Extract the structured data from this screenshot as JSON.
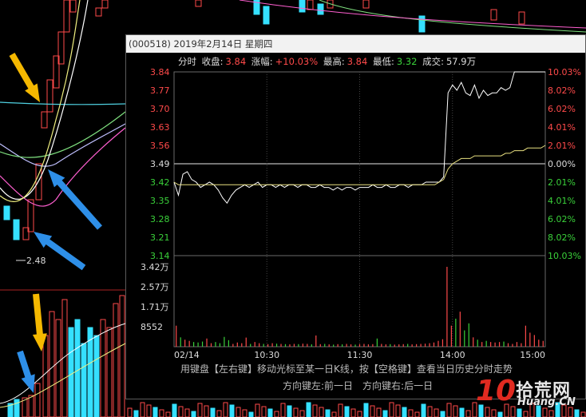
{
  "popup": {
    "title": "(000518) 2019年2月14日 星期四",
    "stats": {
      "label": "分时",
      "close_label": "收盘:",
      "close_value": "3.84",
      "change_label": "涨幅:",
      "change_value": "+10.03%",
      "high_label": "最高:",
      "high_value": "3.84",
      "low_label": "最低:",
      "low_value": "3.32",
      "volume_label": "成交:",
      "volume_value": "57.9万"
    },
    "hint_line1": "用键盘【左右键】移动光标至某一日K线，按【空格键】查看当日历史分时走势",
    "hint_line2": "方向键左:前一日　方向键右:后一日"
  },
  "kline_label": "2.48",
  "watermark": {
    "big": "10",
    "cn": "拾荒网",
    "domain": "Huang.CN"
  },
  "colors": {
    "up": "#ff4a4a",
    "down": "#3ad13a",
    "neutral": "#dddddd",
    "price_line": "#ffffff",
    "avg_line": "#e8e080",
    "arrow_yellow": "#f5b800",
    "arrow_blue": "#2e8fe8"
  },
  "chart_data": {
    "type": "line",
    "title": "",
    "x_ticks": [
      "02/14",
      "10:30",
      "11:30",
      "14:00",
      "15:00"
    ],
    "y_left_ticks": [
      "3.84",
      "3.77",
      "3.70",
      "3.63",
      "3.56",
      "3.49",
      "3.42",
      "3.35",
      "3.28",
      "3.21",
      "3.14"
    ],
    "y_right_ticks": [
      "10.03%",
      "8.02%",
      "6.02%",
      "4.01%",
      "2.01%",
      "0.00%",
      "2.01%",
      "4.01%",
      "6.02%",
      "8.02%",
      "10.03%"
    ],
    "ylim": [
      3.14,
      3.84
    ],
    "prev_close": 3.49,
    "volume_ticks": [
      "3.42万",
      "2.57万",
      "1.71万",
      "8552"
    ],
    "volume_max": 34200,
    "series": [
      {
        "values": [
          3.42,
          3.37,
          3.45,
          3.46,
          3.43,
          3.42,
          3.4,
          3.41,
          3.42,
          3.41,
          3.39,
          3.36,
          3.34,
          3.37,
          3.39,
          3.4,
          3.41,
          3.4,
          3.41,
          3.42,
          3.4,
          3.41,
          3.41,
          3.4,
          3.41,
          3.4,
          3.41,
          3.41,
          3.4,
          3.41,
          3.41,
          3.4,
          3.4,
          3.41,
          3.4,
          3.4,
          3.39,
          3.4,
          3.39,
          3.4,
          3.4,
          3.39,
          3.4,
          3.4,
          3.4,
          3.41,
          3.4,
          3.4,
          3.41,
          3.4,
          3.4,
          3.41,
          3.41,
          3.4,
          3.41,
          3.41,
          3.41,
          3.42,
          3.42,
          3.42,
          3.42,
          3.44,
          3.76,
          3.79,
          3.77,
          3.8,
          3.76,
          3.75,
          3.79,
          3.74,
          3.77,
          3.75,
          3.76,
          3.76,
          3.78,
          3.77,
          3.78,
          3.84,
          3.84,
          3.84,
          3.84,
          3.84,
          3.84,
          3.84,
          3.84
        ]
      },
      {
        "values": [
          3.42,
          3.41,
          3.41,
          3.41,
          3.41,
          3.41,
          3.41,
          3.41,
          3.41,
          3.41,
          3.41,
          3.41,
          3.41,
          3.41,
          3.41,
          3.41,
          3.41,
          3.41,
          3.41,
          3.41,
          3.41,
          3.41,
          3.41,
          3.41,
          3.41,
          3.41,
          3.41,
          3.41,
          3.41,
          3.41,
          3.41,
          3.41,
          3.41,
          3.41,
          3.41,
          3.41,
          3.41,
          3.41,
          3.41,
          3.41,
          3.41,
          3.41,
          3.41,
          3.41,
          3.41,
          3.41,
          3.41,
          3.41,
          3.41,
          3.41,
          3.41,
          3.41,
          3.41,
          3.41,
          3.41,
          3.41,
          3.41,
          3.41,
          3.41,
          3.41,
          3.42,
          3.43,
          3.47,
          3.49,
          3.5,
          3.51,
          3.51,
          3.51,
          3.52,
          3.52,
          3.52,
          3.52,
          3.52,
          3.52,
          3.52,
          3.53,
          3.53,
          3.54,
          3.54,
          3.54,
          3.55,
          3.55,
          3.55,
          3.55,
          3.56
        ]
      }
    ],
    "volume": [
      9000,
      4000,
      3000,
      2500,
      2000,
      1800,
      2200,
      3500,
      1500,
      2000,
      1500,
      4200,
      2800,
      1200,
      1800,
      1500,
      3900,
      1200,
      2000,
      1500,
      1200,
      1100,
      1500,
      1300,
      1200,
      1100,
      1000,
      1200,
      1100,
      1300,
      1200,
      1000,
      4800,
      1100,
      1200,
      1000,
      900,
      1100,
      1000,
      1200,
      1000,
      900,
      1100,
      1200,
      1000,
      1100,
      3500,
      1200,
      1000,
      1100,
      900,
      1000,
      1100,
      1200,
      1000,
      1100,
      1200,
      1300,
      1500,
      1800,
      2500,
      3200,
      34200,
      9000,
      12000,
      15000,
      7000,
      10000,
      4000,
      3000,
      2000,
      2500,
      2000,
      1800,
      2000,
      2200,
      1500,
      1200,
      2000,
      1500,
      9000,
      6000,
      5000,
      3000,
      2500
    ]
  }
}
